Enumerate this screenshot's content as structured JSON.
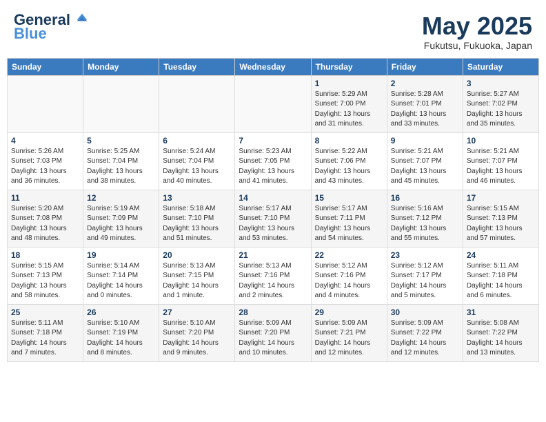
{
  "header": {
    "logo_line1": "General",
    "logo_line2": "Blue",
    "month_title": "May 2025",
    "location": "Fukutsu, Fukuoka, Japan"
  },
  "weekdays": [
    "Sunday",
    "Monday",
    "Tuesday",
    "Wednesday",
    "Thursday",
    "Friday",
    "Saturday"
  ],
  "weeks": [
    [
      {
        "day": "",
        "info": ""
      },
      {
        "day": "",
        "info": ""
      },
      {
        "day": "",
        "info": ""
      },
      {
        "day": "",
        "info": ""
      },
      {
        "day": "1",
        "info": "Sunrise: 5:29 AM\nSunset: 7:00 PM\nDaylight: 13 hours\nand 31 minutes."
      },
      {
        "day": "2",
        "info": "Sunrise: 5:28 AM\nSunset: 7:01 PM\nDaylight: 13 hours\nand 33 minutes."
      },
      {
        "day": "3",
        "info": "Sunrise: 5:27 AM\nSunset: 7:02 PM\nDaylight: 13 hours\nand 35 minutes."
      }
    ],
    [
      {
        "day": "4",
        "info": "Sunrise: 5:26 AM\nSunset: 7:03 PM\nDaylight: 13 hours\nand 36 minutes."
      },
      {
        "day": "5",
        "info": "Sunrise: 5:25 AM\nSunset: 7:04 PM\nDaylight: 13 hours\nand 38 minutes."
      },
      {
        "day": "6",
        "info": "Sunrise: 5:24 AM\nSunset: 7:04 PM\nDaylight: 13 hours\nand 40 minutes."
      },
      {
        "day": "7",
        "info": "Sunrise: 5:23 AM\nSunset: 7:05 PM\nDaylight: 13 hours\nand 41 minutes."
      },
      {
        "day": "8",
        "info": "Sunrise: 5:22 AM\nSunset: 7:06 PM\nDaylight: 13 hours\nand 43 minutes."
      },
      {
        "day": "9",
        "info": "Sunrise: 5:21 AM\nSunset: 7:07 PM\nDaylight: 13 hours\nand 45 minutes."
      },
      {
        "day": "10",
        "info": "Sunrise: 5:21 AM\nSunset: 7:07 PM\nDaylight: 13 hours\nand 46 minutes."
      }
    ],
    [
      {
        "day": "11",
        "info": "Sunrise: 5:20 AM\nSunset: 7:08 PM\nDaylight: 13 hours\nand 48 minutes."
      },
      {
        "day": "12",
        "info": "Sunrise: 5:19 AM\nSunset: 7:09 PM\nDaylight: 13 hours\nand 49 minutes."
      },
      {
        "day": "13",
        "info": "Sunrise: 5:18 AM\nSunset: 7:10 PM\nDaylight: 13 hours\nand 51 minutes."
      },
      {
        "day": "14",
        "info": "Sunrise: 5:17 AM\nSunset: 7:10 PM\nDaylight: 13 hours\nand 53 minutes."
      },
      {
        "day": "15",
        "info": "Sunrise: 5:17 AM\nSunset: 7:11 PM\nDaylight: 13 hours\nand 54 minutes."
      },
      {
        "day": "16",
        "info": "Sunrise: 5:16 AM\nSunset: 7:12 PM\nDaylight: 13 hours\nand 55 minutes."
      },
      {
        "day": "17",
        "info": "Sunrise: 5:15 AM\nSunset: 7:13 PM\nDaylight: 13 hours\nand 57 minutes."
      }
    ],
    [
      {
        "day": "18",
        "info": "Sunrise: 5:15 AM\nSunset: 7:13 PM\nDaylight: 13 hours\nand 58 minutes."
      },
      {
        "day": "19",
        "info": "Sunrise: 5:14 AM\nSunset: 7:14 PM\nDaylight: 14 hours\nand 0 minutes."
      },
      {
        "day": "20",
        "info": "Sunrise: 5:13 AM\nSunset: 7:15 PM\nDaylight: 14 hours\nand 1 minute."
      },
      {
        "day": "21",
        "info": "Sunrise: 5:13 AM\nSunset: 7:16 PM\nDaylight: 14 hours\nand 2 minutes."
      },
      {
        "day": "22",
        "info": "Sunrise: 5:12 AM\nSunset: 7:16 PM\nDaylight: 14 hours\nand 4 minutes."
      },
      {
        "day": "23",
        "info": "Sunrise: 5:12 AM\nSunset: 7:17 PM\nDaylight: 14 hours\nand 5 minutes."
      },
      {
        "day": "24",
        "info": "Sunrise: 5:11 AM\nSunset: 7:18 PM\nDaylight: 14 hours\nand 6 minutes."
      }
    ],
    [
      {
        "day": "25",
        "info": "Sunrise: 5:11 AM\nSunset: 7:18 PM\nDaylight: 14 hours\nand 7 minutes."
      },
      {
        "day": "26",
        "info": "Sunrise: 5:10 AM\nSunset: 7:19 PM\nDaylight: 14 hours\nand 8 minutes."
      },
      {
        "day": "27",
        "info": "Sunrise: 5:10 AM\nSunset: 7:20 PM\nDaylight: 14 hours\nand 9 minutes."
      },
      {
        "day": "28",
        "info": "Sunrise: 5:09 AM\nSunset: 7:20 PM\nDaylight: 14 hours\nand 10 minutes."
      },
      {
        "day": "29",
        "info": "Sunrise: 5:09 AM\nSunset: 7:21 PM\nDaylight: 14 hours\nand 12 minutes."
      },
      {
        "day": "30",
        "info": "Sunrise: 5:09 AM\nSunset: 7:22 PM\nDaylight: 14 hours\nand 12 minutes."
      },
      {
        "day": "31",
        "info": "Sunrise: 5:08 AM\nSunset: 7:22 PM\nDaylight: 14 hours\nand 13 minutes."
      }
    ]
  ]
}
